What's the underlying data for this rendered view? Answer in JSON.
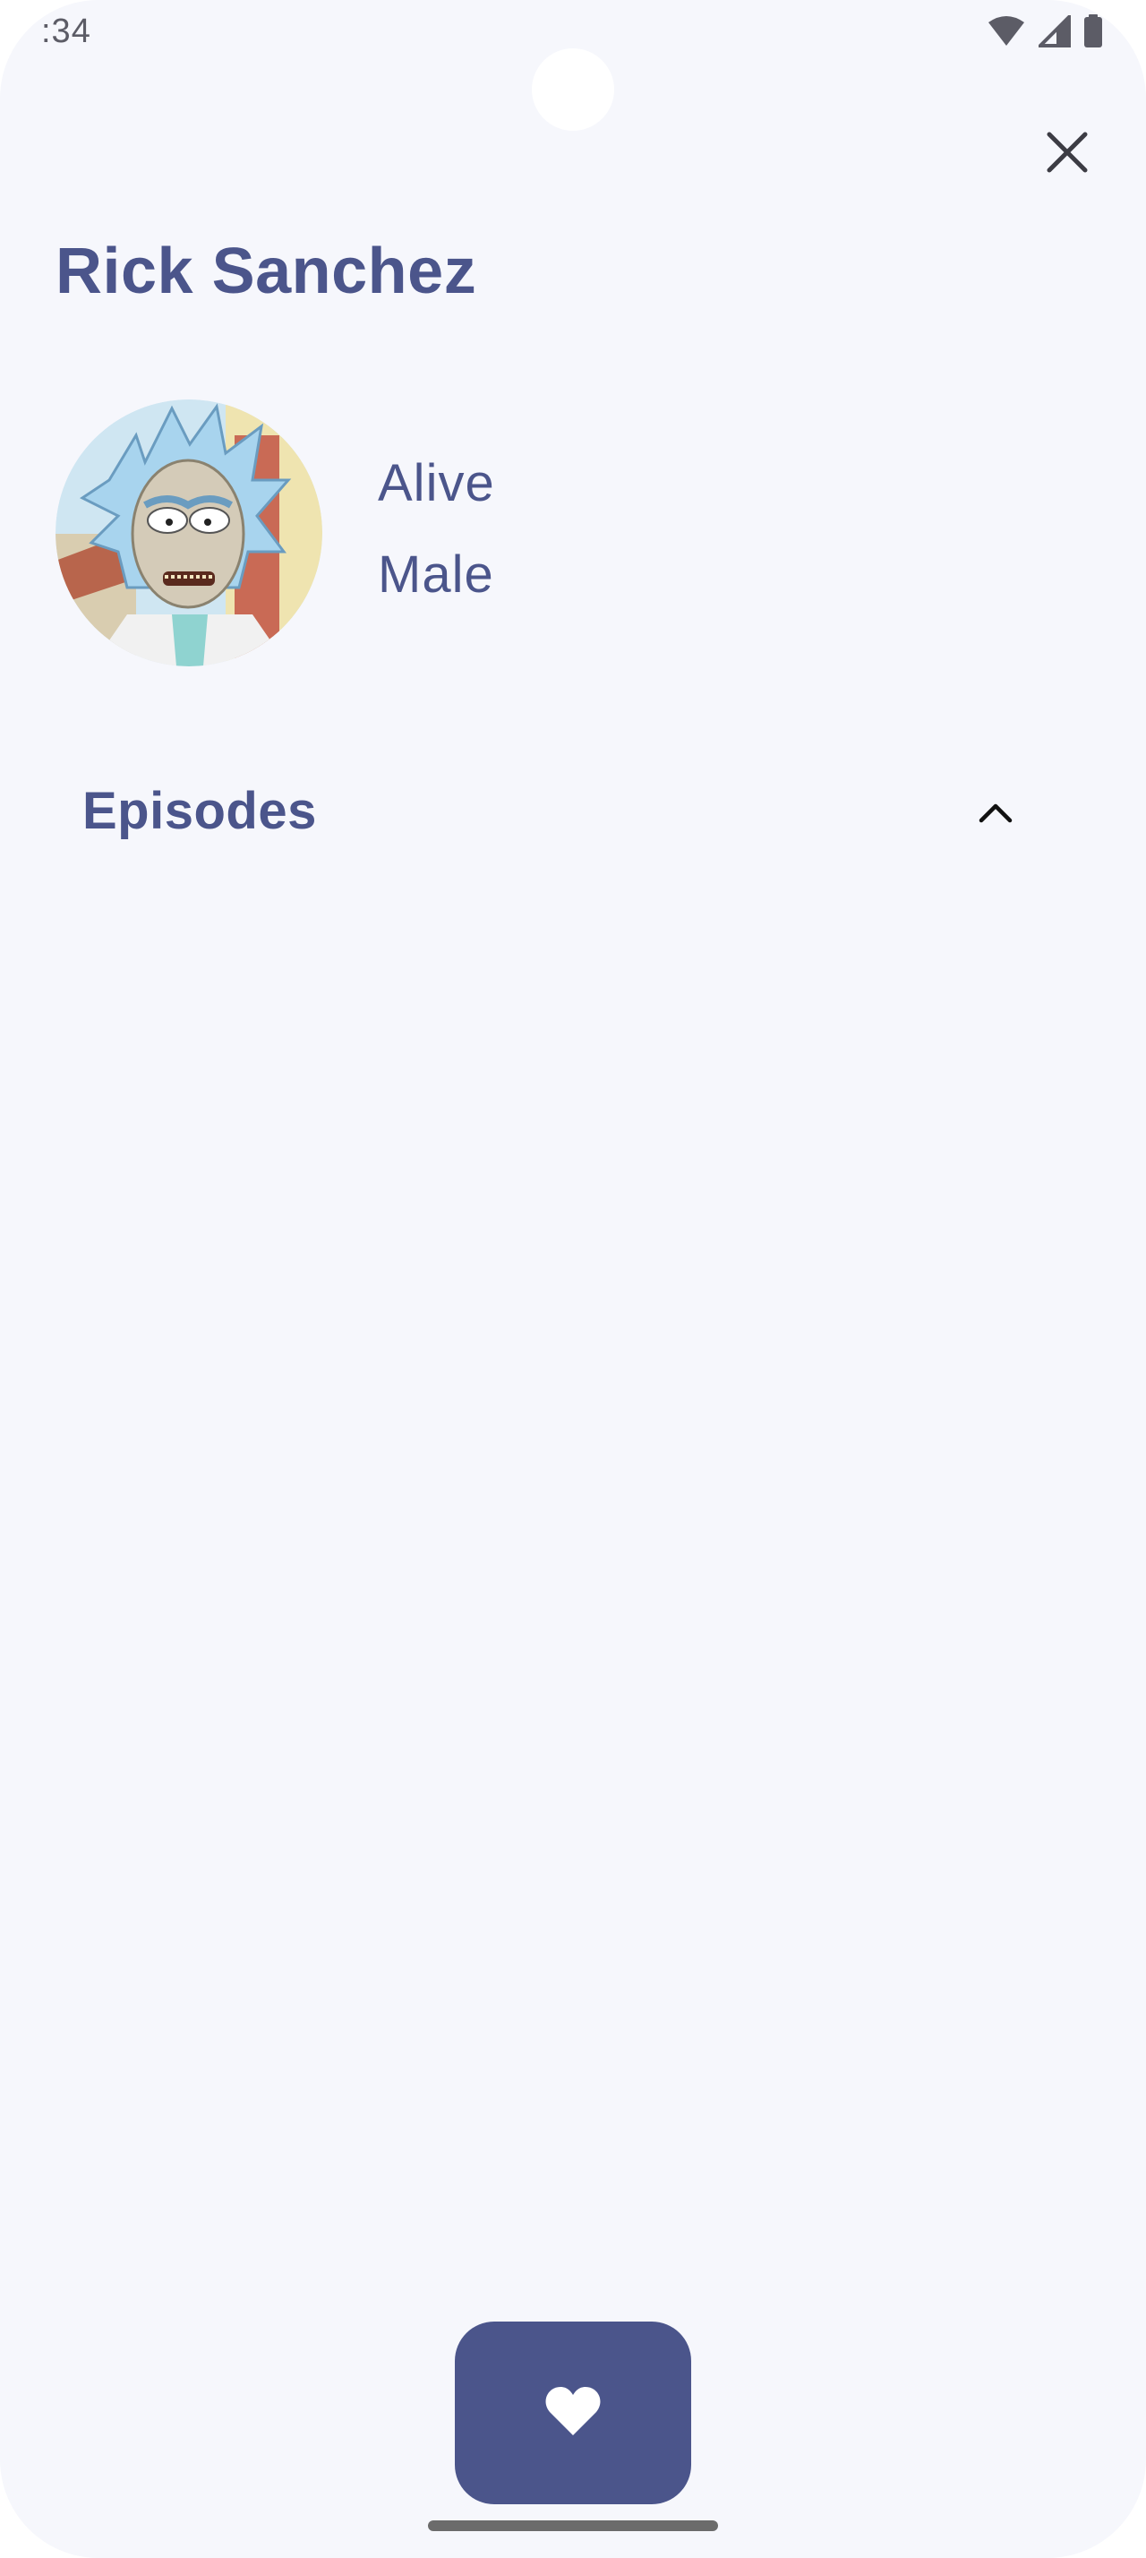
{
  "status_bar": {
    "time": ":34",
    "icons": [
      "wifi-icon",
      "signal-icon",
      "battery-icon"
    ]
  },
  "header": {
    "close_icon": "close-icon"
  },
  "character": {
    "name": "Rick Sanchez",
    "status": "Alive",
    "gender": "Male",
    "avatar_icon": "character-portrait"
  },
  "episodes": {
    "label": "Episodes",
    "expanded": true,
    "toggle_icon": "chevron-up-icon",
    "items": []
  },
  "fab": {
    "icon": "heart-icon"
  },
  "colors": {
    "primary": "#4b558b",
    "background": "#f6f7fc",
    "fab_icon": "#ffffff"
  }
}
